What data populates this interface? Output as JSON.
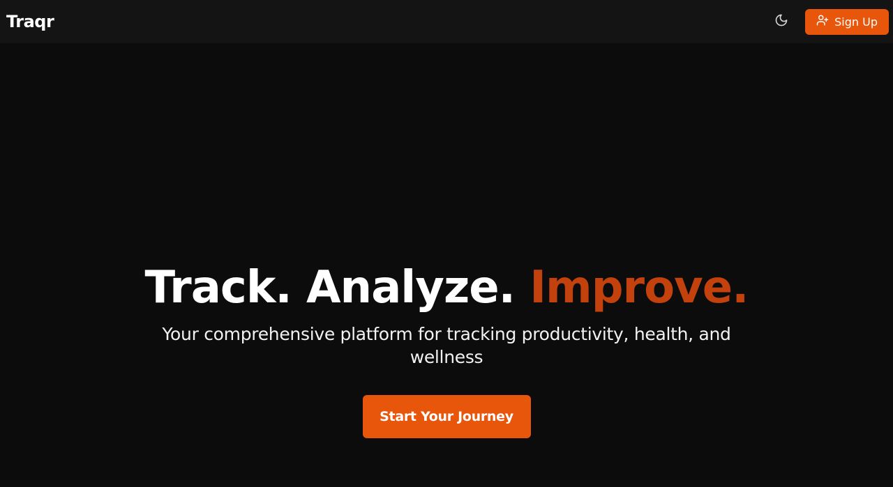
{
  "brand": {
    "name": "Traqr"
  },
  "nav": {
    "theme_icon": "moon-icon",
    "signup_icon": "user-plus-icon",
    "signup_label": "Sign Up"
  },
  "hero": {
    "headline_part1": "Track. Analyze. ",
    "headline_accent": "Improve.",
    "subtitle": "Your comprehensive platform for tracking productivity, health, and wellness",
    "cta_label": "Start Your Journey"
  },
  "colors": {
    "background": "#0c0c0c",
    "navbar": "#141414",
    "accent_button": "#e8560c",
    "accent_text": "#c2410c"
  }
}
